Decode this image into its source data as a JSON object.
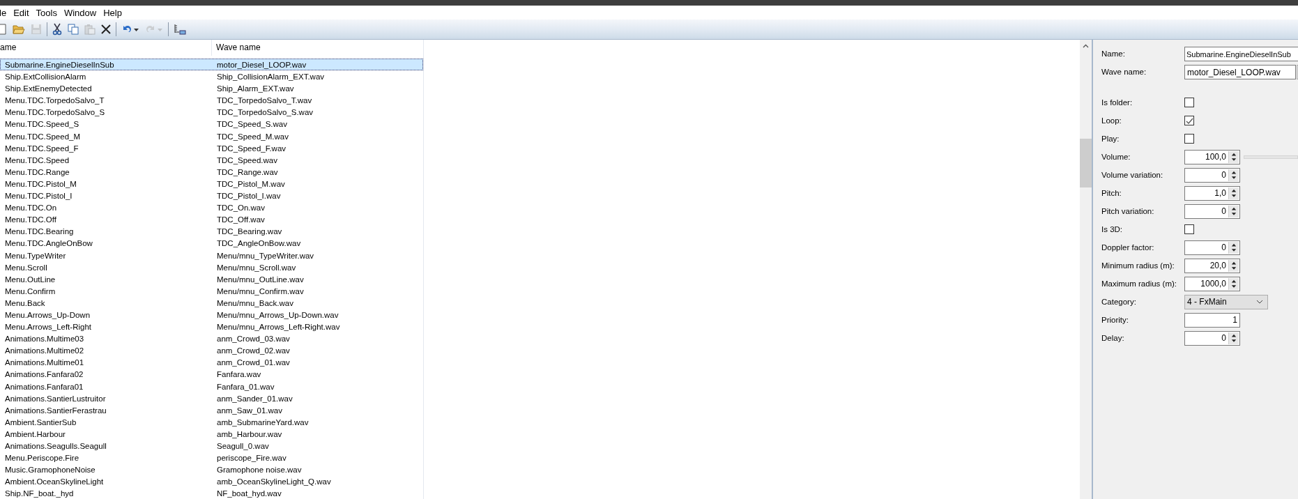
{
  "menu": [
    "le",
    "Edit",
    "Tools",
    "Window",
    "Help"
  ],
  "toolbar": [
    {
      "kind": "new",
      "disabled": false
    },
    {
      "kind": "open",
      "disabled": false
    },
    {
      "kind": "save",
      "disabled": true
    },
    {
      "kind": "sep"
    },
    {
      "kind": "cut",
      "disabled": false
    },
    {
      "kind": "copy",
      "disabled": false
    },
    {
      "kind": "paste",
      "disabled": true
    },
    {
      "kind": "delete",
      "disabled": false
    },
    {
      "kind": "sep"
    },
    {
      "kind": "undo",
      "disabled": false
    },
    {
      "kind": "redo",
      "disabled": true
    },
    {
      "kind": "sep"
    },
    {
      "kind": "tree",
      "disabled": false
    }
  ],
  "table": {
    "columns": [
      "ame",
      "Wave name"
    ],
    "rows": [
      {
        "name": "Submarine.EngineDieselInSub",
        "wave": "motor_Diesel_LOOP.wav",
        "selected": true
      },
      {
        "name": "Ship.ExtCollisionAlarm",
        "wave": "Ship_CollisionAlarm_EXT.wav",
        "selected": false
      },
      {
        "name": "Ship.ExtEnemyDetected",
        "wave": "Ship_Alarm_EXT.wav",
        "selected": false
      },
      {
        "name": "Menu.TDC.TorpedoSalvo_T",
        "wave": "TDC_TorpedoSalvo_T.wav",
        "selected": false
      },
      {
        "name": "Menu.TDC.TorpedoSalvo_S",
        "wave": "TDC_TorpedoSalvo_S.wav",
        "selected": false
      },
      {
        "name": "Menu.TDC.Speed_S",
        "wave": "TDC_Speed_S.wav",
        "selected": false
      },
      {
        "name": "Menu.TDC.Speed_M",
        "wave": "TDC_Speed_M.wav",
        "selected": false
      },
      {
        "name": "Menu.TDC.Speed_F",
        "wave": "TDC_Speed_F.wav",
        "selected": false
      },
      {
        "name": "Menu.TDC.Speed",
        "wave": "TDC_Speed.wav",
        "selected": false
      },
      {
        "name": "Menu.TDC.Range",
        "wave": "TDC_Range.wav",
        "selected": false
      },
      {
        "name": "Menu.TDC.Pistol_M",
        "wave": "TDC_Pistol_M.wav",
        "selected": false
      },
      {
        "name": "Menu.TDC.Pistol_I",
        "wave": "TDC_Pistol_I.wav",
        "selected": false
      },
      {
        "name": "Menu.TDC.On",
        "wave": "TDC_On.wav",
        "selected": false
      },
      {
        "name": "Menu.TDC.Off",
        "wave": "TDC_Off.wav",
        "selected": false
      },
      {
        "name": "Menu.TDC.Bearing",
        "wave": "TDC_Bearing.wav",
        "selected": false
      },
      {
        "name": "Menu.TDC.AngleOnBow",
        "wave": "TDC_AngleOnBow.wav",
        "selected": false
      },
      {
        "name": "Menu.TypeWriter",
        "wave": "Menu/mnu_TypeWriter.wav",
        "selected": false
      },
      {
        "name": "Menu.Scroll",
        "wave": "Menu/mnu_Scroll.wav",
        "selected": false
      },
      {
        "name": "Menu.OutLine",
        "wave": "Menu/mnu_OutLine.wav",
        "selected": false
      },
      {
        "name": "Menu.Confirm",
        "wave": "Menu/mnu_Confirm.wav",
        "selected": false
      },
      {
        "name": "Menu.Back",
        "wave": "Menu/mnu_Back.wav",
        "selected": false
      },
      {
        "name": "Menu.Arrows_Up-Down",
        "wave": "Menu/mnu_Arrows_Up-Down.wav",
        "selected": false
      },
      {
        "name": "Menu.Arrows_Left-Right",
        "wave": "Menu/mnu_Arrows_Left-Right.wav",
        "selected": false
      },
      {
        "name": "Animations.Multime03",
        "wave": "anm_Crowd_03.wav",
        "selected": false
      },
      {
        "name": "Animations.Multime02",
        "wave": "anm_Crowd_02.wav",
        "selected": false
      },
      {
        "name": "Animations.Multime01",
        "wave": "anm_Crowd_01.wav",
        "selected": false
      },
      {
        "name": "Animations.Fanfara02",
        "wave": "Fanfara.wav",
        "selected": false
      },
      {
        "name": "Animations.Fanfara01",
        "wave": "Fanfara_01.wav",
        "selected": false
      },
      {
        "name": "Animations.SantierLustruitor",
        "wave": "anm_Sander_01.wav",
        "selected": false
      },
      {
        "name": "Animations.SantierFerastrau",
        "wave": "anm_Saw_01.wav",
        "selected": false
      },
      {
        "name": "Ambient.SantierSub",
        "wave": "amb_SubmarineYard.wav",
        "selected": false
      },
      {
        "name": "Ambient.Harbour",
        "wave": "amb_Harbour.wav",
        "selected": false
      },
      {
        "name": "Animations.Seagulls.Seagull",
        "wave": "Seagull_0.wav",
        "selected": false
      },
      {
        "name": "Menu.Periscope.Fire",
        "wave": "periscope_Fire.wav",
        "selected": false
      },
      {
        "name": "Music.GramophoneNoise",
        "wave": "Gramophone noise.wav",
        "selected": false
      },
      {
        "name": "Ambient.OceanSkylineLight",
        "wave": "amb_OceanSkylineLight_Q.wav",
        "selected": false
      },
      {
        "name": "Ship.NF_boat._hyd",
        "wave": "NF_boat_hyd.wav",
        "selected": false
      }
    ]
  },
  "properties": [
    {
      "kind": "text",
      "label": "Name:",
      "value": "Submarine.EngineDieselInSub"
    },
    {
      "kind": "file",
      "label": "Wave name:",
      "value": "motor_Diesel_LOOP.wav"
    },
    {
      "kind": "gap"
    },
    {
      "kind": "check",
      "label": "Is folder:",
      "checked": false
    },
    {
      "kind": "check",
      "label": "Loop:",
      "checked": true
    },
    {
      "kind": "check",
      "label": "Play:",
      "checked": false
    },
    {
      "kind": "slider",
      "label": "Volume:",
      "value": "100,0"
    },
    {
      "kind": "spin",
      "label": "Volume variation:",
      "value": "0"
    },
    {
      "kind": "spin",
      "label": "Pitch:",
      "value": "1,0"
    },
    {
      "kind": "spin",
      "label": "Pitch variation:",
      "value": "0"
    },
    {
      "kind": "check",
      "label": "Is 3D:",
      "checked": false
    },
    {
      "kind": "spin",
      "label": "Doppler factor:",
      "value": "0"
    },
    {
      "kind": "spin",
      "label": "Minimum radius (m):",
      "value": "20,0"
    },
    {
      "kind": "spin",
      "label": "Maximum radius (m):",
      "value": "1000,0"
    },
    {
      "kind": "combo",
      "label": "Category:",
      "value": "4 - FxMain"
    },
    {
      "kind": "number",
      "label": "Priority:",
      "value": "1"
    },
    {
      "kind": "spin",
      "label": "Delay:",
      "value": "0"
    }
  ]
}
